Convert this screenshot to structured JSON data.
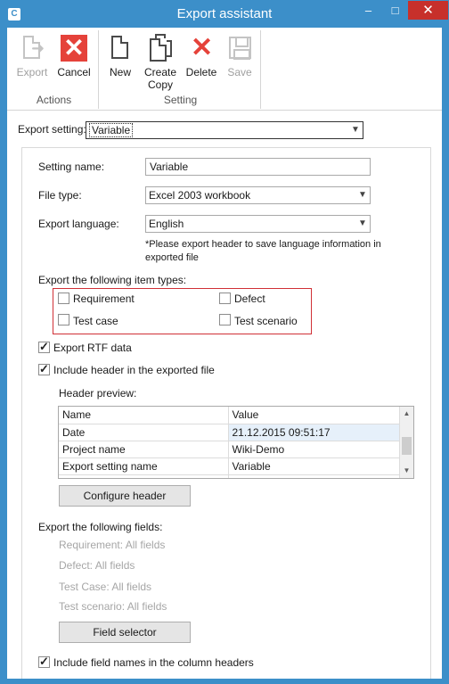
{
  "window": {
    "title": "Export assistant",
    "app_icon": "C",
    "minimize_glyph": "–",
    "maximize_glyph": "□",
    "close_glyph": "✕"
  },
  "ribbon": {
    "actions_group_label": "Actions",
    "setting_group_label": "Setting",
    "export_label": "Export",
    "cancel_label": "Cancel",
    "new_label": "New",
    "create_copy_line1": "Create",
    "create_copy_line2": "Copy",
    "delete_label": "Delete",
    "save_label": "Save"
  },
  "export_setting": {
    "label": "Export setting:",
    "value": "Variable"
  },
  "form": {
    "setting_name_label": "Setting name:",
    "setting_name_value": "Variable",
    "file_type_label": "File type:",
    "file_type_value": "Excel 2003 workbook",
    "language_label": "Export language:",
    "language_value": "English",
    "language_note_line1": "*Please export header to save language information in",
    "language_note_line2": "exported file"
  },
  "item_types": {
    "heading": "Export the following item types:",
    "requirement": "Requirement",
    "defect": "Defect",
    "test_case": "Test case",
    "test_scenario": "Test scenario"
  },
  "options": {
    "export_rtf": "Export RTF data",
    "include_header": "Include header in the exported file",
    "header_preview": "Header preview:"
  },
  "header_grid": {
    "columns": [
      "Name",
      "Value"
    ],
    "rows": [
      {
        "name": "Date",
        "value": "21.12.2015 09:51:17"
      },
      {
        "name": "Project name",
        "value": "Wiki-Demo"
      },
      {
        "name": "Export setting name",
        "value": "Variable"
      }
    ]
  },
  "configure_header_button": "Configure header",
  "fields": {
    "heading": "Export the following fields:",
    "requirement": "Requirement: All fields",
    "defect": "Defect: All fields",
    "test_case": "Test Case: All fields",
    "test_scenario": "Test scenario: All fields",
    "field_selector_button": "Field selector",
    "include_field_names": "Include field names in the column headers"
  }
}
